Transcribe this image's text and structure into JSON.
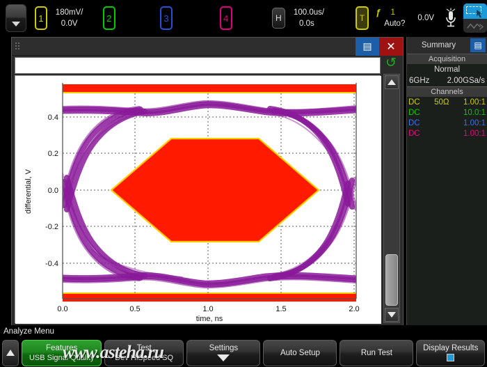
{
  "topbar": {
    "menu_button": "menu-dropdown",
    "channels": [
      {
        "id": "1",
        "label": "1",
        "color": "#cccc00",
        "scale": "180mV/",
        "offset": "0.0V"
      },
      {
        "id": "2",
        "label": "2",
        "color": "#00cc00"
      },
      {
        "id": "3",
        "label": "3",
        "color": "#2a4fd8"
      },
      {
        "id": "4",
        "label": "4",
        "color": "#e0007f"
      }
    ],
    "horizontal": {
      "badge": "H",
      "scale": "100.0us/",
      "position": "0.0s"
    },
    "trigger": {
      "badge": "T",
      "edge_icon": "ƒ",
      "source": "1",
      "mode": "Auto?",
      "level": "0.0V"
    },
    "mic_icon": "microphone-icon",
    "tool_select_icon": "selection-tool-icon",
    "tool_wave_icon": "waveform-tool-icon"
  },
  "window": {
    "title": "",
    "doc_button": "▤",
    "close_button": "✕",
    "refresh_icon": "↺"
  },
  "right_panel": {
    "title": "Summary",
    "collapse_icon": "▤",
    "sections": {
      "acquisition": {
        "header": "Acquisition",
        "mode": "Normal",
        "bandwidth": "6GHz",
        "sample_rate": "2.00GSa/s"
      },
      "channels": {
        "header": "Channels",
        "rows": [
          {
            "coupling": "DC",
            "impedance": "50Ω",
            "probe": "1.00:1",
            "color": "#cccc00"
          },
          {
            "coupling": "DC",
            "impedance": "",
            "probe": "10.0:1",
            "color": "#00cc00"
          },
          {
            "coupling": "DC",
            "impedance": "",
            "probe": "1.00:1",
            "color": "#3a6ef0"
          },
          {
            "coupling": "DC",
            "impedance": "",
            "probe": "1.00:1",
            "color": "#f0007f"
          }
        ]
      }
    }
  },
  "bottom": {
    "menu_label": "Analyze Menu",
    "up_button": "up-arrow",
    "buttons": [
      {
        "name": "features",
        "line1": "Features",
        "line2": "USB Signal Quality",
        "style": "green"
      },
      {
        "name": "test",
        "line1": "Test",
        "line2": "Dev HiSpeed SQ",
        "style": "dark"
      },
      {
        "name": "settings",
        "line1": "Settings",
        "line2": "",
        "style": "dark",
        "glyph": "down-arrow"
      },
      {
        "name": "auto-setup",
        "line1": "Auto Setup",
        "line2": "",
        "style": "dark"
      },
      {
        "name": "run-test",
        "line1": "Run Test",
        "line2": "",
        "style": "dark"
      },
      {
        "name": "display-results",
        "line1": "Display Results",
        "line2": "",
        "style": "dark",
        "glyph": "square-indicator"
      }
    ]
  },
  "watermark": {
    "text": "www.asteha.ru"
  },
  "chart_data": {
    "type": "line",
    "title": "",
    "xlabel": "time, ns",
    "ylabel": "differential, V",
    "xlim": [
      -0.05,
      2.1
    ],
    "ylim": [
      -0.56,
      0.56
    ],
    "xticks": [
      "0.0",
      "0.5",
      "1.0",
      "1.5",
      "2.0"
    ],
    "xtick_values": [
      0.0,
      0.5,
      1.0,
      1.5,
      2.0
    ],
    "yticks": [
      "0.4",
      "0.2",
      "0.0",
      "-0.2",
      "-0.4"
    ],
    "ytick_values": [
      0.4,
      0.2,
      0.0,
      -0.2,
      -0.4
    ],
    "grid": true,
    "legend": "none",
    "plot_bg": "#ffffff",
    "trace_color": "#8a1a9a",
    "mask_color": "#ff1a00",
    "mask_edge_color": "#ffcc00",
    "series": [
      {
        "name": "eye-diagram-trace",
        "type": "eye",
        "description": "USB high-speed differential eye diagram, overlaid bit transitions",
        "high_level": 0.44,
        "low_level": -0.42,
        "crossing_level": 0.0,
        "unit_interval_ns": 2.08,
        "rise_time_ns": 0.4
      }
    ],
    "masks": [
      {
        "name": "eye-mask-center",
        "shape": "hexagon",
        "vertices_time_ns": [
          0.33,
          0.74,
          1.34,
          1.75,
          1.34,
          0.74
        ],
        "vertices_volts": [
          0.0,
          0.285,
          0.285,
          0.0,
          -0.285,
          -0.285
        ]
      },
      {
        "name": "eye-mask-top",
        "shape": "band",
        "y_from": 0.5,
        "y_to": 0.56
      },
      {
        "name": "eye-mask-bottom",
        "shape": "band",
        "y_from": -0.56,
        "y_to": -0.5
      }
    ],
    "mask_violations": 0
  }
}
